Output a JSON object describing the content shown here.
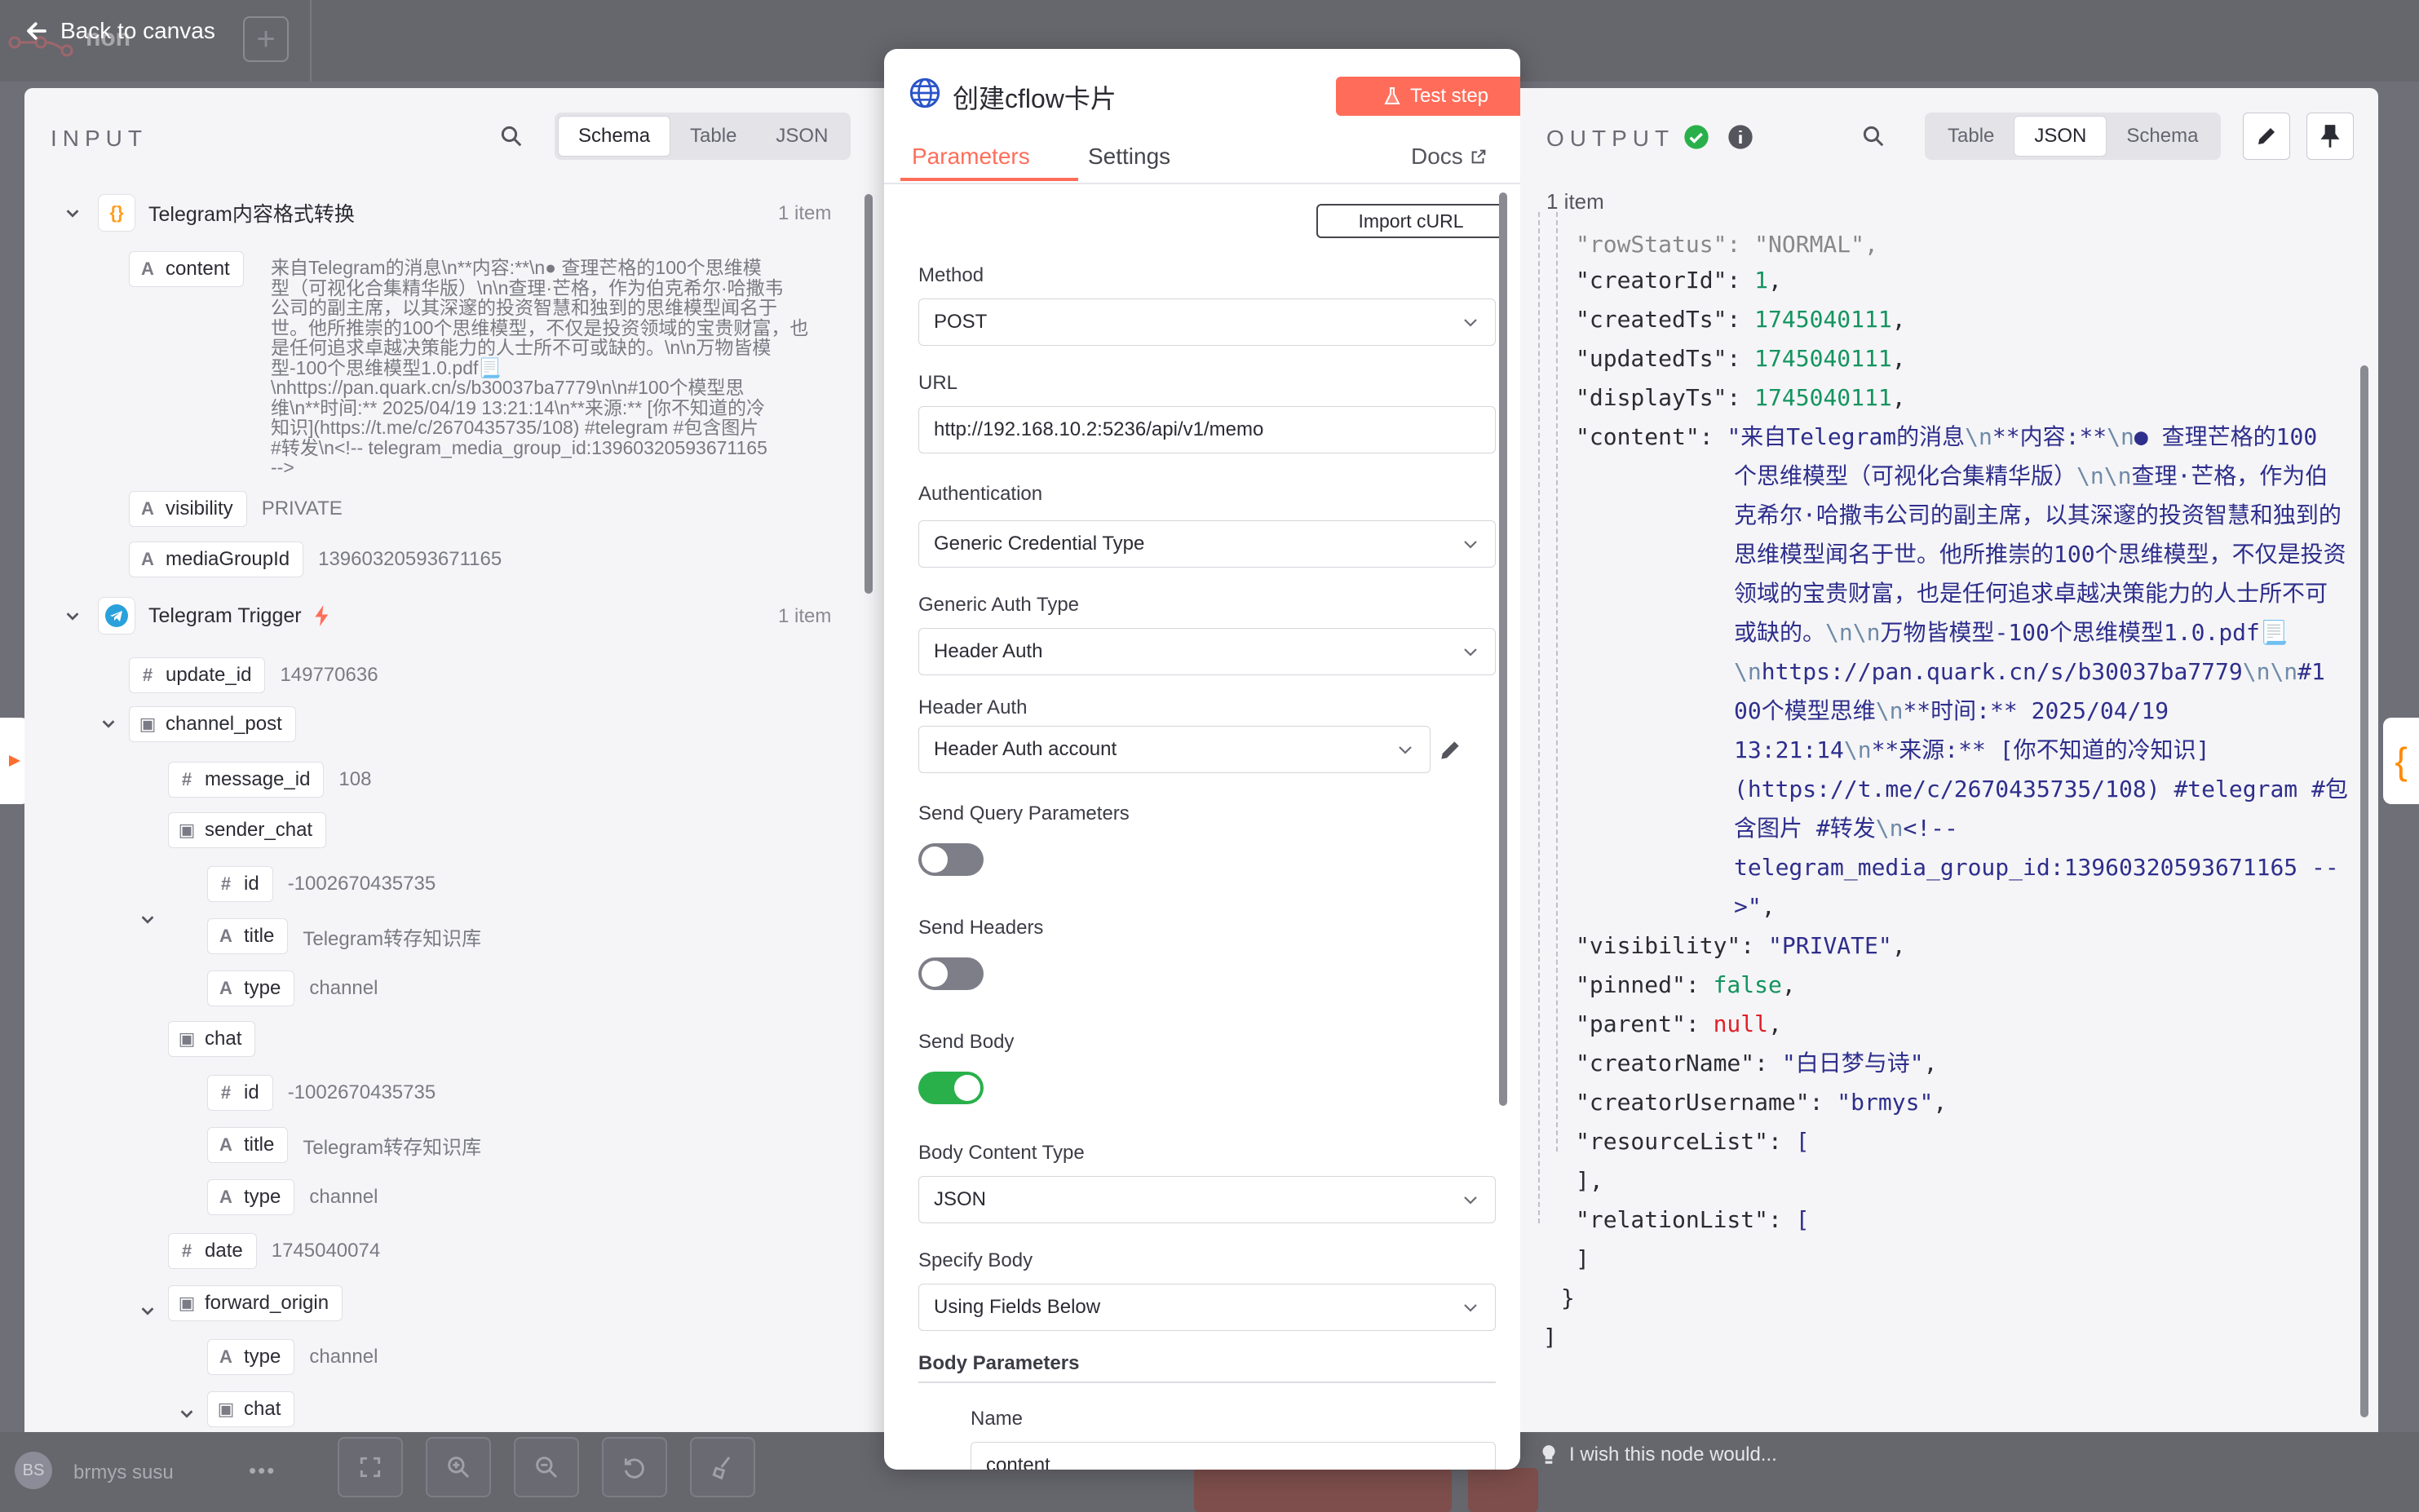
{
  "header": {
    "back_label": "Back to canvas",
    "workflow_name": "non",
    "add_tab": "+"
  },
  "footer": {
    "user_initials": "BS",
    "user_name": "brmys susu",
    "more": "•••",
    "feedback": "I wish this node would..."
  },
  "input": {
    "title": "INPUT",
    "views": [
      "Schema",
      "Table",
      "JSON"
    ],
    "active_view": "Schema",
    "nodes": [
      {
        "name": "Telegram内容格式转换",
        "count": "1 item",
        "fields": [
          {
            "key": "content",
            "lines": [
              "来自Telegram的消息\\n**内容:**\\n● 查理芒格的100个思维模",
              "型（可视化合集精华版）\\n\\n查理·芒格，作为伯克希尔·哈撒韦",
              "公司的副主席，以其深邃的投资智慧和独到的思维模型闻名于",
              "世。他所推崇的100个思维模型，不仅是投资领域的宝贵财富，也",
              "是任何追求卓越决策能力的人士所不可或缺的。\\n\\n万物皆模",
              "型-100个思维模型1.0.pdf📃",
              "\\nhttps://pan.quark.cn/s/b30037ba7779\\n\\n#100个模型思",
              "维\\n**时间:** 2025/04/19 13:21:14\\n**来源:** [你不知道的冷",
              "知识](https://t.me/c/2670435735/108) #telegram #包含图片",
              "#转发\\n<!-- telegram_media_group_id:13960320593671165",
              "-->"
            ]
          },
          {
            "key": "visibility",
            "value": "PRIVATE"
          },
          {
            "key": "mediaGroupId",
            "value": "13960320593671165"
          }
        ]
      },
      {
        "name": "Telegram Trigger",
        "count": "1 item",
        "fields": [
          {
            "key": "update_id",
            "value": "149770636"
          },
          {
            "key": "channel_post"
          },
          {
            "key": "message_id",
            "value": "108"
          },
          {
            "key": "sender_chat"
          },
          {
            "key": "id",
            "value": "-1002670435735"
          },
          {
            "key": "title",
            "value": "Telegram转存知识库"
          },
          {
            "key": "type",
            "value": "channel"
          },
          {
            "key": "chat"
          },
          {
            "key": "id",
            "value": "-1002670435735"
          },
          {
            "key": "title",
            "value": "Telegram转存知识库"
          },
          {
            "key": "type",
            "value": "channel"
          },
          {
            "key": "date",
            "value": "1745040074"
          },
          {
            "key": "forward_origin"
          },
          {
            "key": "type",
            "value": "channel"
          },
          {
            "key": "chat"
          }
        ]
      }
    ]
  },
  "node": {
    "title": "创建cflow卡片",
    "test_button": "Test step",
    "tabs": [
      "Parameters",
      "Settings"
    ],
    "docs": "Docs",
    "import_curl": "Import cURL",
    "method_label": "Method",
    "method": "POST",
    "url_label": "URL",
    "url": "http://192.168.10.2:5236/api/v1/memo",
    "auth_label": "Authentication",
    "auth": "Generic Credential Type",
    "generic_auth_label": "Generic Auth Type",
    "generic_auth": "Header Auth",
    "header_auth_label": "Header Auth",
    "header_auth": "Header Auth account",
    "send_query_label": "Send Query Parameters",
    "send_query": false,
    "send_headers_label": "Send Headers",
    "send_headers": false,
    "send_body_label": "Send Body",
    "send_body": true,
    "body_type_label": "Body Content Type",
    "body_type": "JSON",
    "specify_body_label": "Specify Body",
    "specify_body": "Using Fields Below",
    "body_params_label": "Body Parameters",
    "name_label": "Name",
    "name_value": "content"
  },
  "output": {
    "title": "OUTPUT",
    "views": [
      "Table",
      "JSON",
      "Schema"
    ],
    "active_view": "JSON",
    "count": "1 item"
  },
  "colors": {
    "accent": "#ff6d5a",
    "success": "#29b04b",
    "json_number": "#14945f",
    "json_string": "#2e2e8c",
    "json_null": "#e0202a"
  }
}
